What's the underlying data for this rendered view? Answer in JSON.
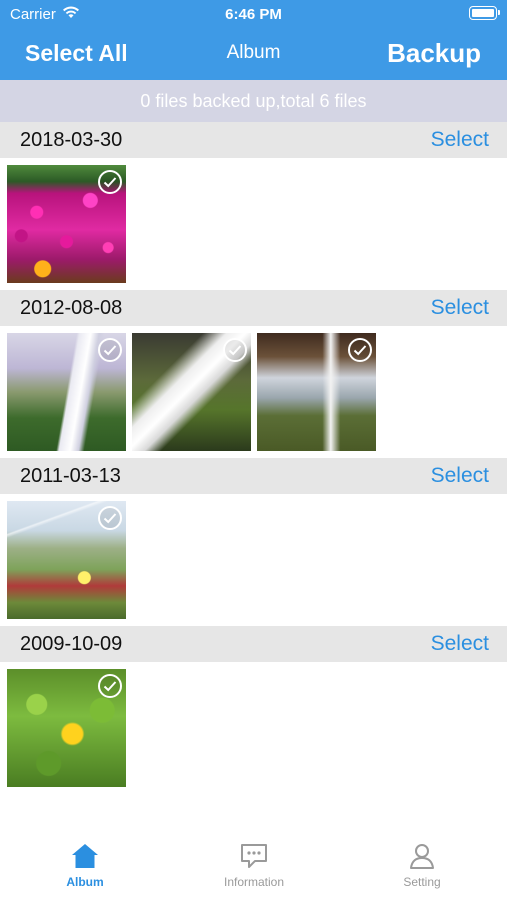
{
  "status_bar": {
    "carrier": "Carrier",
    "time": "6:46 PM",
    "wifi_icon": "wifi-icon",
    "battery_icon": "battery-icon"
  },
  "nav": {
    "left_label": "Select All",
    "title": "Album",
    "right_label": "Backup"
  },
  "summary": {
    "text": "0 files backed up,total 6 files"
  },
  "colors": {
    "accent": "#3e9ae6",
    "link": "#2b8fe0",
    "summary_bg": "#d4d5e4",
    "section_bg": "#e6e6e6"
  },
  "sections": [
    {
      "date": "2018-03-30",
      "select_label": "Select"
    },
    {
      "date": "2012-08-08",
      "select_label": "Select"
    },
    {
      "date": "2011-03-13",
      "select_label": "Select"
    },
    {
      "date": "2009-10-09",
      "select_label": "Select"
    }
  ],
  "tabs": [
    {
      "label": "Album",
      "icon": "home-icon",
      "selected": true
    },
    {
      "label": "Information",
      "icon": "chat-bubble-icon",
      "selected": false
    },
    {
      "label": "Setting",
      "icon": "person-icon",
      "selected": false
    }
  ]
}
